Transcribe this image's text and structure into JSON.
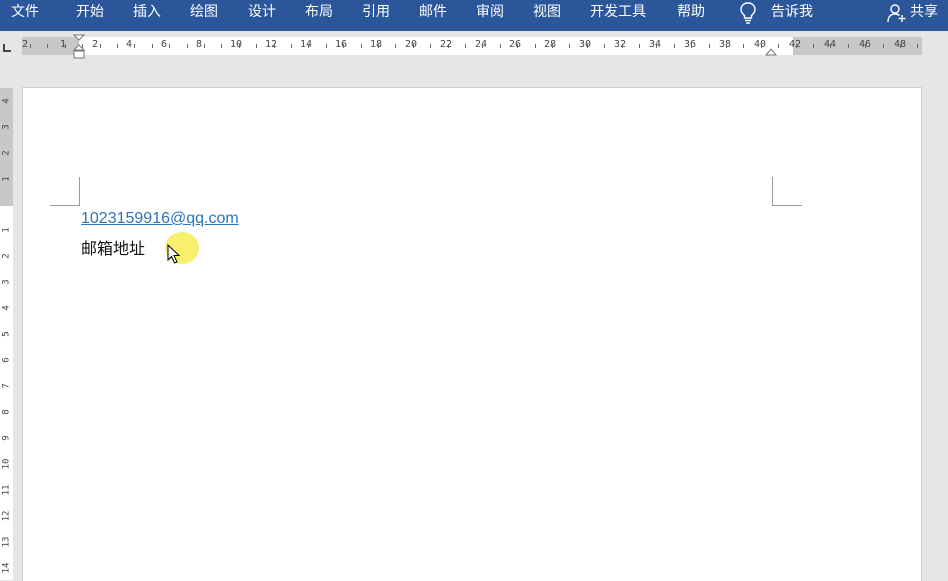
{
  "ribbon": {
    "tabs": [
      {
        "label": "文件"
      },
      {
        "label": "开始"
      },
      {
        "label": "插入"
      },
      {
        "label": "绘图"
      },
      {
        "label": "设计"
      },
      {
        "label": "布局"
      },
      {
        "label": "引用"
      },
      {
        "label": "邮件"
      },
      {
        "label": "审阅"
      },
      {
        "label": "视图"
      },
      {
        "label": "开发工具"
      },
      {
        "label": "帮助"
      }
    ],
    "tell_me_label": "告诉我",
    "share_label": "共享",
    "icons": {
      "tell_me": "lightbulb-icon",
      "share": "person-add-icon"
    }
  },
  "ruler": {
    "horizontal_labels": [
      "2",
      "1",
      "2",
      "4",
      "6",
      "8",
      "10",
      "12",
      "14",
      "16",
      "18",
      "20",
      "22",
      "24",
      "26",
      "28",
      "30",
      "32",
      "34",
      "36",
      "38",
      "40",
      "42",
      "44",
      "46",
      "48"
    ],
    "vertical_labels": [
      "4",
      "3",
      "2",
      "1",
      "1",
      "2",
      "3",
      "4",
      "5",
      "6",
      "7",
      "8",
      "9",
      "10",
      "11",
      "12",
      "13",
      "14"
    ]
  },
  "document": {
    "email_link": "1023159916@qq.com",
    "address_text": "邮箱地址"
  },
  "colors": {
    "ribbon_bg": "#2b579a",
    "link": "#2e74b5",
    "cursor_highlight": "#f5eb3c"
  }
}
